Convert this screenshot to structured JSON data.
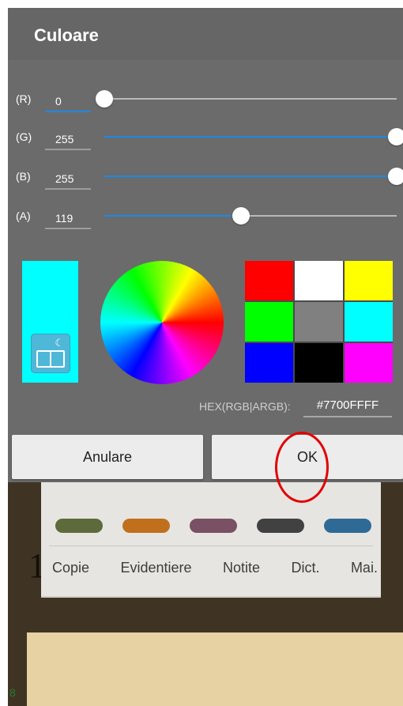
{
  "dialog": {
    "title": "Culoare",
    "rows": [
      {
        "label": "(R)",
        "value": "0",
        "fraction": 0.0,
        "active": true
      },
      {
        "label": "(G)",
        "value": "255",
        "fraction": 1.0,
        "active": false
      },
      {
        "label": "(B)",
        "value": "255",
        "fraction": 1.0,
        "active": false
      },
      {
        "label": "(A)",
        "value": "119",
        "fraction": 0.467,
        "active": false
      }
    ],
    "preview_color": "#00FFFF",
    "preview_icon": "book-moon-icon",
    "palette": [
      "#FF0000",
      "#FFFFFF",
      "#FFFF00",
      "#00FF00",
      "#808080",
      "#00FFFF",
      "#0000FF",
      "#000000",
      "#FF00FF"
    ],
    "hex_label": "HEX(RGB|ARGB):",
    "hex_value": "#7700FFFF",
    "cancel_label": "Anulare",
    "ok_label": "OK",
    "accent": "#1E88E5",
    "annotation_color": "#E20000"
  },
  "background": {
    "digit": "1",
    "selection_swatches": [
      "#5d6b3c",
      "#c0701c",
      "#7a5064",
      "#414141",
      "#2f6a96"
    ],
    "selection_actions": [
      "Copie",
      "Evidentiere",
      "Notite",
      "Dict.",
      "Mai."
    ]
  }
}
